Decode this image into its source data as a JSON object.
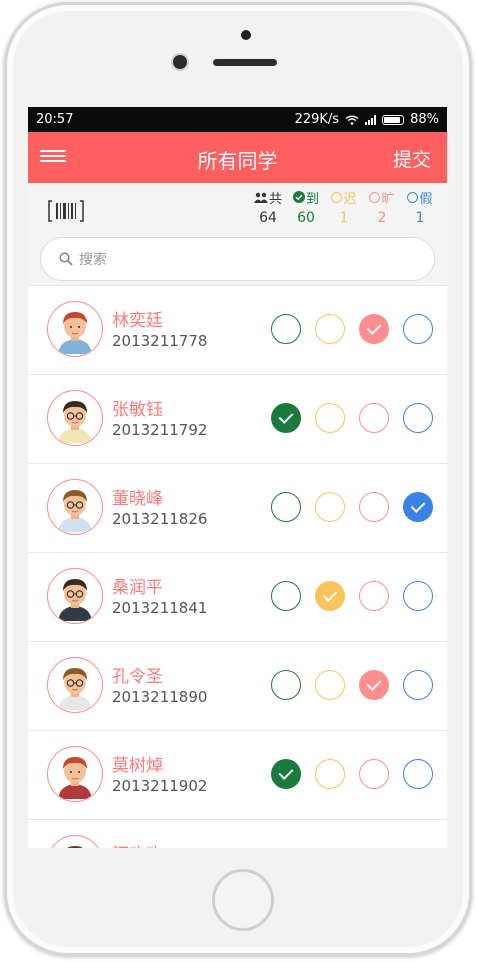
{
  "status_bar": {
    "time": "20:57",
    "speed": "229K/s",
    "battery": "88%"
  },
  "app_bar": {
    "title": "所有同学",
    "submit_label": "提交"
  },
  "summary": {
    "total": {
      "label": "共",
      "count": "64",
      "color": "#333333"
    },
    "present": {
      "label": "到",
      "count": "60",
      "color": "#1a7a3c"
    },
    "late": {
      "label": "迟",
      "count": "1",
      "color": "#f8c55a"
    },
    "absent": {
      "label": "旷",
      "count": "2",
      "color": "#ff8f8f"
    },
    "leave": {
      "label": "假",
      "count": "1",
      "color": "#3b82e6"
    }
  },
  "search": {
    "placeholder": "搜索"
  },
  "students": [
    {
      "name": "林奕廷",
      "id": "2013211778",
      "status": "absent"
    },
    {
      "name": "张敏钰",
      "id": "2013211792",
      "status": "present"
    },
    {
      "name": "董晓峰",
      "id": "2013211826",
      "status": "leave"
    },
    {
      "name": "桑润平",
      "id": "2013211841",
      "status": "late"
    },
    {
      "name": "孔令圣",
      "id": "2013211890",
      "status": "absent"
    },
    {
      "name": "莫树焯",
      "id": "2013211902",
      "status": "present"
    },
    {
      "name": "汪欢欢",
      "id": "",
      "status": "present"
    }
  ]
}
